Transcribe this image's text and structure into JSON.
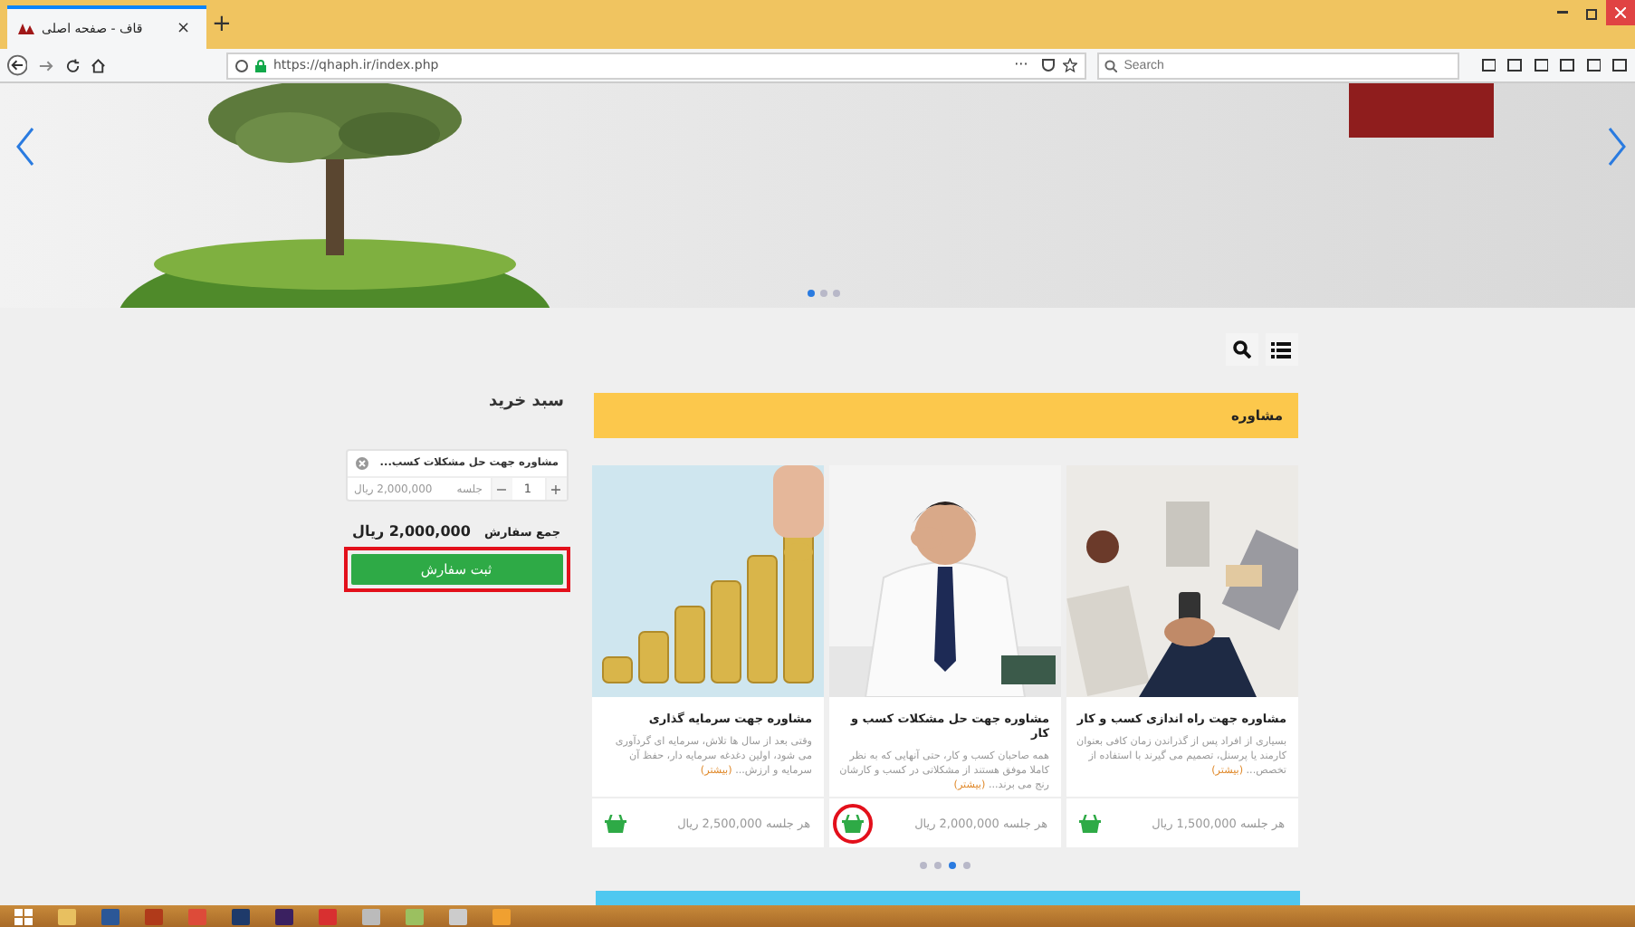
{
  "browser": {
    "tabs": [
      {
        "title": "قاف - صفحه اصلی",
        "close": "×",
        "selected": true
      }
    ],
    "new_tab": "+",
    "address": "https://qhaph.ir/index.php",
    "page_actions": "···",
    "search": {
      "placeholder": "Search"
    }
  },
  "banner": {
    "dots": [
      {
        "selected": true
      },
      {
        "selected": false
      },
      {
        "selected": false
      }
    ]
  },
  "category": {
    "title": "مشاوره"
  },
  "cart": {
    "title": "سبد خرید",
    "items": [
      {
        "name": "مشاوره جهت حل مشکلات کسب...",
        "plus": "+",
        "quantity": "1",
        "minus": "−",
        "unit": "جلسه",
        "price": "2,000,000 ریال"
      }
    ],
    "total_label": "جمع سفارش",
    "total": "2,000,000 ریال",
    "submit": "ثبت سفارش"
  },
  "products": [
    {
      "title": "مشاوره جهت راه اندازی کسب و کار",
      "description": "بسیاری از افراد پس از گذراندن زمان کافی بعنوان کارمند یا پرسنل، تصمیم می گیرند با استفاده از تخصص...",
      "more": "(بیشتر)",
      "price": "هر جلسه 1,500,000 ریال",
      "highlighted": false
    },
    {
      "title": "مشاوره جهت حل مشکلات کسب و کار",
      "description": "همه صاحبان کسب و کار، حتی آنهایی که به نظر کاملا موفق هستند از مشکلاتی در کسب و کارشان رنج می برند...",
      "more": "(بیشتر)",
      "price": "هر جلسه 2,000,000 ریال",
      "highlighted": true
    },
    {
      "title": "مشاوره جهت سرمایه گذاری",
      "description": "وقتی بعد از سال ها تلاش، سرمایه ای گردآوری می شود، اولین دغدغه سرمایه دار، حفظ آن سرمایه و ارزش...",
      "more": "(بیشتر)",
      "price": "هر جلسه 2,500,000 ریال",
      "highlighted": false
    }
  ],
  "product_dots": [
    {
      "selected": false
    },
    {
      "selected": false
    },
    {
      "selected": true
    },
    {
      "selected": false
    }
  ],
  "annotations": {
    "submit_highlighted": true
  }
}
